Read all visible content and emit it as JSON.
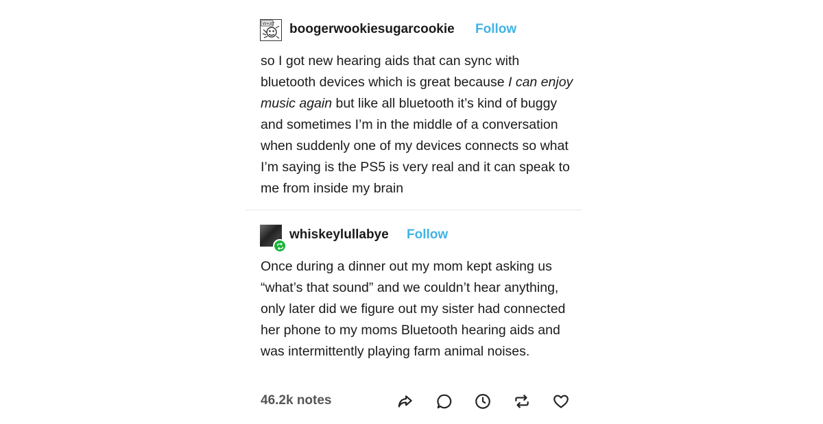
{
  "posts": [
    {
      "username": "boogerwookiesugarcookie",
      "follow_label": "Follow",
      "avatar_text": "WHAT",
      "text_parts": {
        "p1": "so I got new hearing aids that can sync with bluetooth devices which is great because ",
        "em": "I can enjoy music again",
        "p2": " but like all bluetooth it’s kind of buggy and sometimes I’m in the middle of a conversation when suddenly one of my devices connects so what I’m saying is the PS5 is very real and it can speak to me from inside my brain"
      }
    },
    {
      "username": "whiskeylullabye",
      "follow_label": "Follow",
      "text": "Once during a dinner out my mom kept asking us “what’s that sound” and we couldn’t hear anything, only later did we figure out my sister had connected her phone to my moms Bluetooth hearing aids and was intermittently playing farm animal noises."
    }
  ],
  "footer": {
    "notes": "46.2k notes",
    "actions": [
      "share-icon",
      "reply-icon",
      "history-icon",
      "reblog-icon",
      "like-icon"
    ]
  },
  "colors": {
    "follow": "#3fb3e6",
    "reblog_badge": "#19b33a",
    "text": "#1a1a1a",
    "notes": "#555555"
  }
}
